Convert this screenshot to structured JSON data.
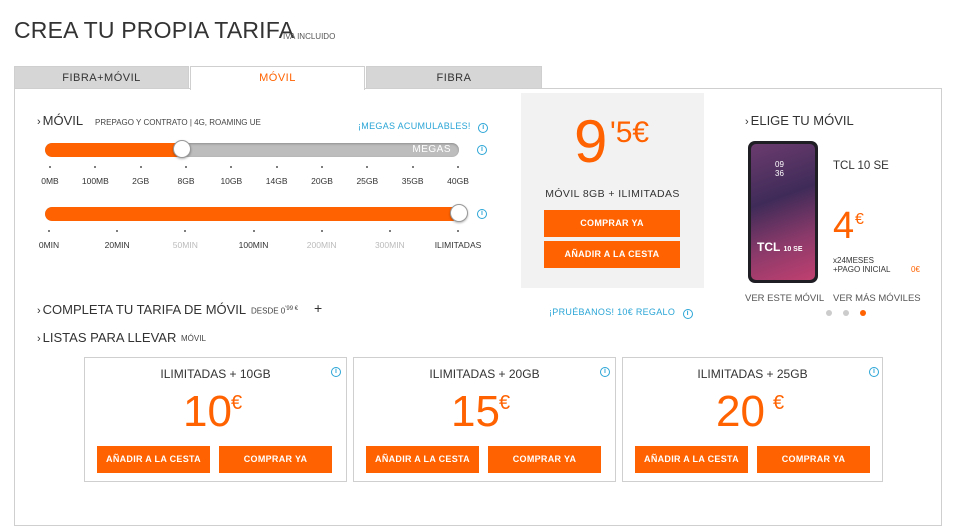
{
  "header": {
    "title": "CREA TU PROPIA TARIFA",
    "subtitle": "IVA INCLUIDO"
  },
  "tabs": [
    {
      "label": "FIBRA+MÓVIL",
      "active": false
    },
    {
      "label": "MÓVIL",
      "active": true
    },
    {
      "label": "FIBRA",
      "active": false
    }
  ],
  "movil": {
    "title": "MÓVIL",
    "subtitle": "PREPAGO Y CONTRATO | 4G, ROAMING UE",
    "megas_link": "¡MEGAS ACUMULABLES!",
    "data_slider": {
      "track_label": "MEGAS",
      "ticks": [
        "0MB",
        "100MB",
        "2GB",
        "8GB",
        "10GB",
        "14GB",
        "20GB",
        "25GB",
        "35GB",
        "40GB"
      ],
      "selected": "8GB",
      "fill_fraction": 0.33
    },
    "minutes_slider": {
      "ticks": [
        "0MIN",
        "20MIN",
        "50MIN",
        "100MIN",
        "200MIN",
        "300MIN",
        "ILIMITADAS"
      ],
      "disabled_ticks": [
        "50MIN",
        "200MIN",
        "300MIN"
      ],
      "selected": "ILIMITADAS",
      "fill_fraction": 1.0
    }
  },
  "price_box": {
    "integer": "9",
    "decimal": "'5€",
    "plan": "MÓVIL 8GB + ILIMITADAS",
    "buy_label": "COMPRAR YA",
    "cart_label": "AÑADIR A LA CESTA",
    "promo_link": "¡PRUÉBANOS! 10€ REGALO"
  },
  "phone": {
    "section_title": "ELIGE TU MÓVIL",
    "model": "TCL 10 SE",
    "price": "4",
    "currency": "€",
    "terms_line1": "x24MESES",
    "terms_line2": "+PAGO INICIAL",
    "initial_payment": "0€",
    "screen_time": "09",
    "screen_time2": "36",
    "screen_brand": "TCL",
    "screen_model": "10 SE",
    "view_link": "VER ESTE MÓVIL",
    "more_link": "VER MÁS MÓVILES",
    "carousel_count": 3,
    "carousel_active": 3
  },
  "complete": {
    "title": "COMPLETA TU TARIFA DE MÓVIL",
    "from_label": "DESDE 0",
    "from_sup": "'99 €",
    "plus": "+"
  },
  "listas": {
    "title": "LISTAS PARA LLEVAR",
    "subtitle": "MÓVIL",
    "cards": [
      {
        "name": "ILIMITADAS + 10GB",
        "price": "10",
        "currency": "€",
        "cart_label": "AÑADIR A LA CESTA",
        "buy_label": "COMPRAR YA"
      },
      {
        "name": "ILIMITADAS + 20GB",
        "price": "15",
        "currency": "€",
        "cart_label": "AÑADIR A LA CESTA",
        "buy_label": "COMPRAR YA"
      },
      {
        "name": "ILIMITADAS + 25GB",
        "price": "20",
        "currency": "€",
        "cart_label": "AÑADIR A LA CESTA",
        "buy_label": "COMPRAR YA"
      }
    ]
  },
  "colors": {
    "accent": "#ff6200",
    "info": "#2aa5d6",
    "tab_bg": "#d6d6d6",
    "box_bg": "#f2f2f2"
  },
  "icons": {
    "info": "info-icon",
    "chevron": "chevron-right-icon"
  }
}
